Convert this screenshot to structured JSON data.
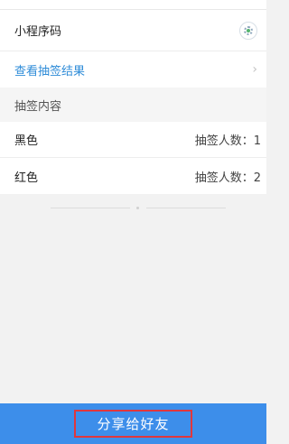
{
  "settings": {
    "mini_program_code_label": "小程序码",
    "view_results_label": "查看抽签结果"
  },
  "draw_content": {
    "header": "抽签内容",
    "items": [
      {
        "name": "黑色",
        "count_label": "抽签人数：1"
      },
      {
        "name": "红色",
        "count_label": "抽签人数：2"
      }
    ]
  },
  "footer": {
    "share_label": "分享给好友"
  },
  "icons": {
    "mini_program_code": "qr-code-icon",
    "chevron": "chevron-right-icon"
  },
  "colors": {
    "link": "#2f8cd8",
    "primary": "#3d8eea",
    "highlight_border": "#e0373d"
  }
}
